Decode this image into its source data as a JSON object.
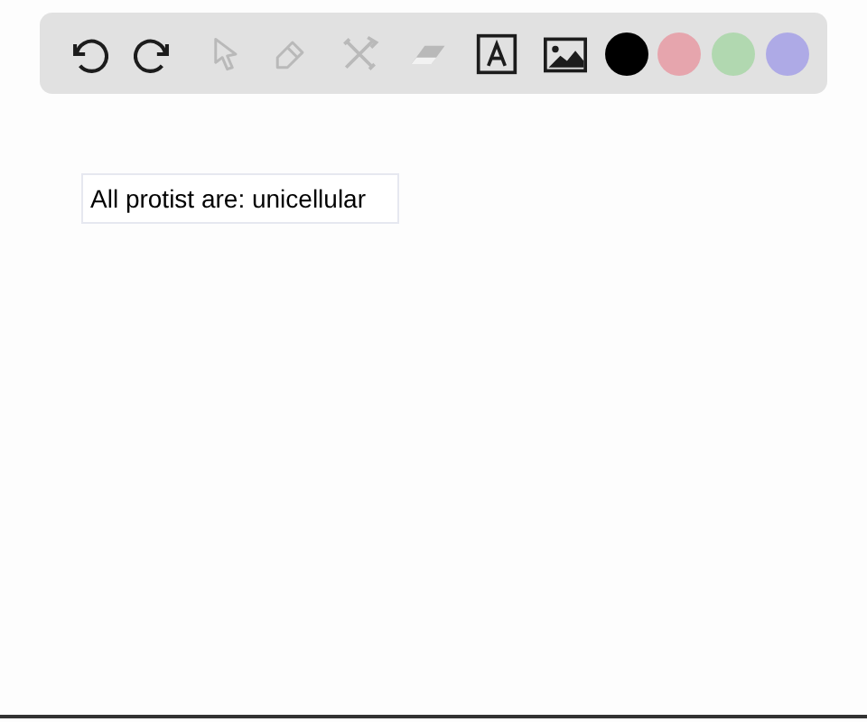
{
  "toolbar": {
    "tools": [
      {
        "kind": "undo",
        "disabled": false
      },
      {
        "kind": "redo",
        "disabled": false
      },
      {
        "kind": "pointer",
        "disabled": true
      },
      {
        "kind": "pencil",
        "disabled": true
      },
      {
        "kind": "tools",
        "disabled": true
      },
      {
        "kind": "eraser",
        "disabled": true
      },
      {
        "kind": "text",
        "disabled": false
      },
      {
        "kind": "image",
        "disabled": false
      }
    ],
    "colors": [
      {
        "color": "#000000"
      },
      {
        "color": "#e6a5ad"
      },
      {
        "color": "#b1d8b0"
      },
      {
        "color": "#aeaae6"
      }
    ]
  },
  "text_box": {
    "value": "All protist are: unicellular"
  }
}
